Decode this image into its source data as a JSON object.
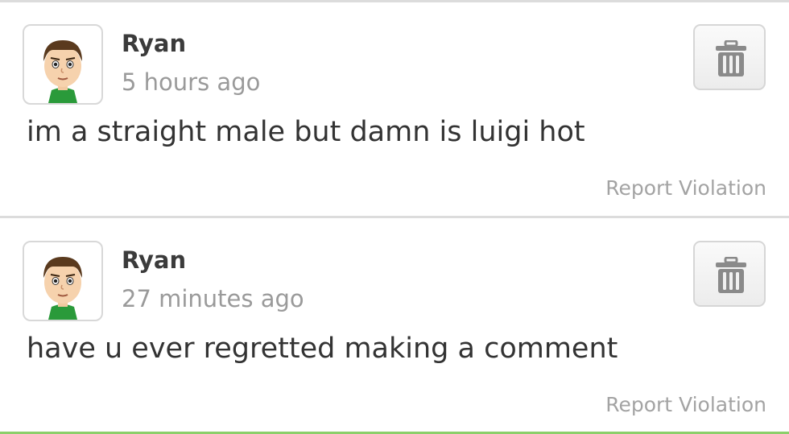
{
  "comments": [
    {
      "author": "Ryan",
      "time": "5 hours ago",
      "text": "im a straight male but damn is luigi hot",
      "report_label": "Report Violation",
      "delete_icon": "trash-icon",
      "avatar_icon": "mii-avatar-icon"
    },
    {
      "author": "Ryan",
      "time": "27 minutes ago",
      "text": "have u ever regretted making a comment",
      "report_label": "Report Violation",
      "delete_icon": "trash-icon",
      "avatar_icon": "mii-avatar-icon"
    }
  ],
  "colors": {
    "divider": "#dcdcdc",
    "accent_bottom": "#8ccf6a",
    "author_text": "#3b3b3b",
    "meta_text": "#9a9a9a"
  }
}
